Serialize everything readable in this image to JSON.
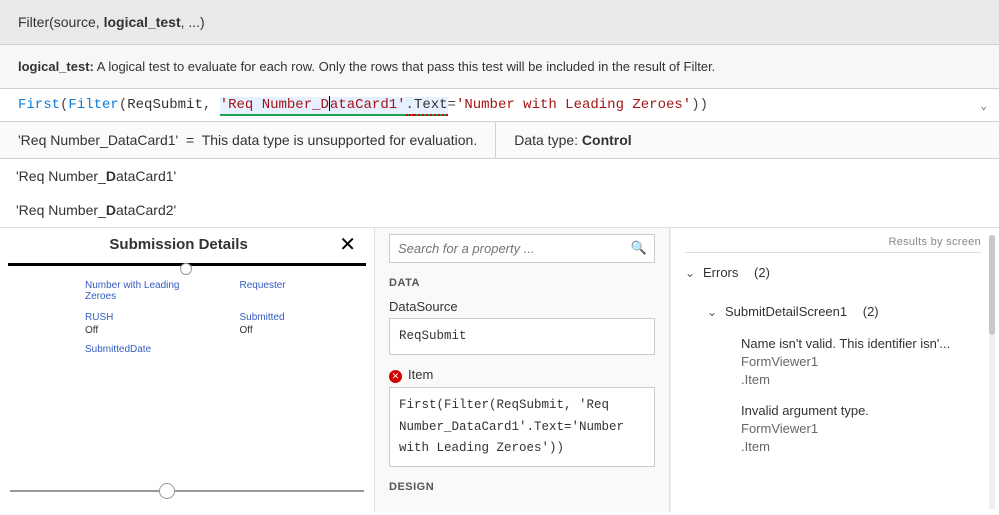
{
  "signature": {
    "fn": "Filter",
    "text_prefix": "Filter(source, ",
    "bold_arg": "logical_test",
    "text_suffix": ", ...)"
  },
  "description": {
    "label": "logical_test:",
    "text": " A logical test to evaluate for each row. Only the rows that pass this test will be included in the result of Filter."
  },
  "formula": {
    "fn1": "First",
    "p1": "(",
    "fn2": "Filter",
    "p2": "(",
    "arg1": "ReqSubmit",
    "comma": ", ",
    "lit1a": "'Req Number_D",
    "lit1b": "ataCard1'",
    "dot": ".",
    "prop": "Text",
    "eq": "=",
    "lit2": "'Number with Leading Zeroes'",
    "close": "))"
  },
  "eval": {
    "lhs": "'Req Number_DataCard1'",
    "eq": "=",
    "msg": "This data type is unsupported for evaluation.",
    "dtype_label": "Data type: ",
    "dtype_value": "Control"
  },
  "autocomplete": [
    {
      "prefix": "'Req Number_",
      "bold": "D",
      "suffix": "ataCard1'"
    },
    {
      "prefix": "'Req Number_",
      "bold": "D",
      "suffix": "ataCard2'"
    }
  ],
  "canvas": {
    "title": "Submission Details",
    "fields": [
      {
        "left_label": "Number with Leading Zeroes",
        "left_value": "",
        "right_label": "Requester",
        "right_value": ""
      },
      {
        "left_label": "RUSH",
        "left_value": "Off",
        "right_label": "Submitted",
        "right_value": "Off"
      },
      {
        "left_label": "SubmittedDate",
        "left_value": "",
        "right_label": "",
        "right_value": ""
      }
    ]
  },
  "props": {
    "search_placeholder": "Search for a property ...",
    "section_data": "DATA",
    "datasource_label": "DataSource",
    "datasource_value": "ReqSubmit",
    "item_label": "Item",
    "item_value": "First(Filter(ReqSubmit, 'Req Number_DataCard1'.Text='Number with Leading Zeroes'))",
    "section_design": "DESIGN"
  },
  "errors": {
    "header": "Results by screen",
    "group_errors": "Errors",
    "group_errors_count": "(2)",
    "subgroup": "SubmitDetailScreen1",
    "subgroup_count": "(2)",
    "items": [
      {
        "msg": "Name isn't valid. This identifier isn'...",
        "ctrl": "FormViewer1",
        "prop": ".Item"
      },
      {
        "msg": "Invalid argument type.",
        "ctrl": "FormViewer1",
        "prop": ".Item"
      }
    ]
  }
}
